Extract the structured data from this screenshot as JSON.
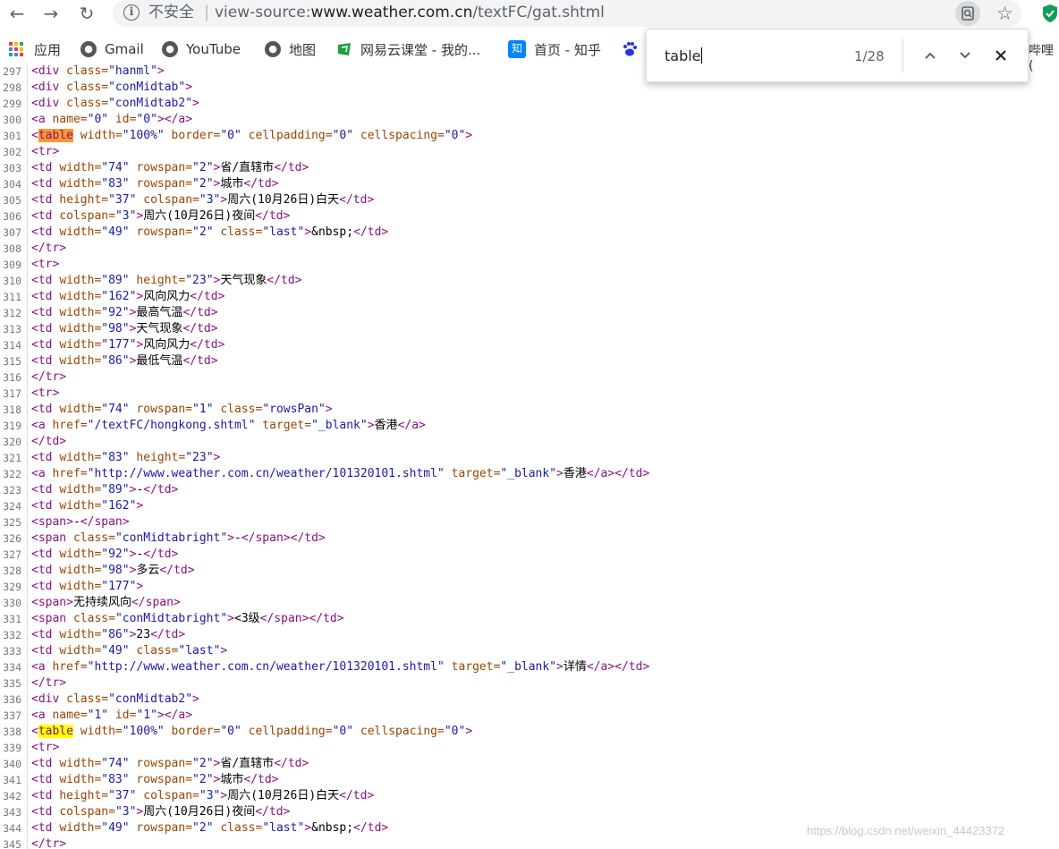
{
  "address_bar": {
    "security_label": "不安全",
    "separator": "|",
    "url_prefix": "view-source:",
    "url_domain": "www.weather.com.cn",
    "url_path": "/textFC/gat.shtml"
  },
  "bookmarks": [
    {
      "label": "应用",
      "icon": "apps-icon"
    },
    {
      "label": "Gmail",
      "icon": "globe-icon"
    },
    {
      "label": "YouTube",
      "icon": "globe-icon"
    },
    {
      "label": "地图",
      "icon": "globe-icon"
    },
    {
      "label": "网易云课堂 - 我的...",
      "icon": "netease-icon"
    },
    {
      "label": "首页 - 知乎",
      "icon": "zhihu-icon"
    },
    {
      "label": "",
      "icon": "baidu-icon"
    }
  ],
  "bookmarks_overflow_text": "哔哩 (",
  "find_bar": {
    "query": "table",
    "count": "1/28"
  },
  "source_lines": [
    {
      "n": "297",
      "html": "<span class=\"t\">&lt;div </span><span class=\"a\">class=</span><span class=\"v\">\"hanml\"</span><span class=\"t\">&gt;</span>"
    },
    {
      "n": "298",
      "html": "<span class=\"t\">&lt;div </span><span class=\"a\">class=</span><span class=\"v\">\"conMidtab\"</span><span class=\"t\">&gt;</span>"
    },
    {
      "n": "299",
      "html": "<span class=\"t\">&lt;div </span><span class=\"a\">class=</span><span class=\"v\">\"conMidtab2\"</span><span class=\"t\">&gt;</span>"
    },
    {
      "n": "300",
      "html": "<span class=\"t\">&lt;a </span><span class=\"a\">name=</span><span class=\"v\">\"0\"</span><span class=\"a\"> id=</span><span class=\"v\">\"0\"</span><span class=\"t\">&gt;&lt;/a&gt;</span>"
    },
    {
      "n": "301",
      "html": "<span class=\"t\">&lt;<span class=\"mt\">table</span> </span><span class=\"a\">width=</span><span class=\"v\">\"100%\"</span><span class=\"a\"> border=</span><span class=\"v\">\"0\"</span><span class=\"a\"> cellpadding=</span><span class=\"v\">\"0\"</span><span class=\"a\"> cellspacing=</span><span class=\"v\">\"0\"</span><span class=\"t\">&gt;</span>"
    },
    {
      "n": "302",
      "html": "<span class=\"t\">&lt;tr&gt;</span>"
    },
    {
      "n": "303",
      "html": "<span class=\"t\">&lt;td </span><span class=\"a\">width=</span><span class=\"v\">\"74\"</span><span class=\"a\"> rowspan=</span><span class=\"v\">\"2\"</span><span class=\"t\">&gt;</span>省/直辖市<span class=\"t\">&lt;/td&gt;</span>"
    },
    {
      "n": "304",
      "html": "<span class=\"t\">&lt;td </span><span class=\"a\">width=</span><span class=\"v\">\"83\"</span><span class=\"a\"> rowspan=</span><span class=\"v\">\"2\"</span><span class=\"t\">&gt;</span>城市<span class=\"t\">&lt;/td&gt;</span>"
    },
    {
      "n": "305",
      "html": "<span class=\"t\">&lt;td </span><span class=\"a\">height=</span><span class=\"v\">\"37\"</span><span class=\"a\"> colspan=</span><span class=\"v\">\"3\"</span><span class=\"t\">&gt;</span>周六(10月26日)白天<span class=\"t\">&lt;/td&gt;</span>"
    },
    {
      "n": "306",
      "html": "<span class=\"t\">&lt;td </span><span class=\"a\">colspan=</span><span class=\"v\">\"3\"</span><span class=\"t\">&gt;</span>周六(10月26日)夜间<span class=\"t\">&lt;/td&gt;</span>"
    },
    {
      "n": "307",
      "html": "<span class=\"t\">&lt;td </span><span class=\"a\">width=</span><span class=\"v\">\"49\"</span><span class=\"a\"> rowspan=</span><span class=\"v\">\"2\"</span><span class=\"a\"> class=</span><span class=\"v\">\"last\"</span><span class=\"t\">&gt;</span>&amp;nbsp;<span class=\"t\">&lt;/td&gt;</span>"
    },
    {
      "n": "308",
      "html": "<span class=\"t\">&lt;/tr&gt;</span>"
    },
    {
      "n": "309",
      "html": "<span class=\"t\">&lt;tr&gt;</span>"
    },
    {
      "n": "310",
      "html": "<span class=\"t\">&lt;td </span><span class=\"a\">width=</span><span class=\"v\">\"89\"</span><span class=\"a\"> height=</span><span class=\"v\">\"23\"</span><span class=\"t\">&gt;</span>天气现象<span class=\"t\">&lt;/td&gt;</span>"
    },
    {
      "n": "311",
      "html": "<span class=\"t\">&lt;td </span><span class=\"a\">width=</span><span class=\"v\">\"162\"</span><span class=\"t\">&gt;</span>风向风力<span class=\"t\">&lt;/td&gt;</span>"
    },
    {
      "n": "312",
      "html": "<span class=\"t\">&lt;td </span><span class=\"a\">width=</span><span class=\"v\">\"92\"</span><span class=\"t\">&gt;</span>最高气温<span class=\"t\">&lt;/td&gt;</span>"
    },
    {
      "n": "313",
      "html": "<span class=\"t\">&lt;td </span><span class=\"a\">width=</span><span class=\"v\">\"98\"</span><span class=\"t\">&gt;</span>天气现象<span class=\"t\">&lt;/td&gt;</span>"
    },
    {
      "n": "314",
      "html": "<span class=\"t\">&lt;td </span><span class=\"a\">width=</span><span class=\"v\">\"177\"</span><span class=\"t\">&gt;</span>风向风力<span class=\"t\">&lt;/td&gt;</span>"
    },
    {
      "n": "315",
      "html": "<span class=\"t\">&lt;td </span><span class=\"a\">width=</span><span class=\"v\">\"86\"</span><span class=\"t\">&gt;</span>最低气温<span class=\"t\">&lt;/td&gt;</span>"
    },
    {
      "n": "316",
      "html": "<span class=\"t\">&lt;/tr&gt;</span>"
    },
    {
      "n": "317",
      "html": "<span class=\"t\">&lt;tr&gt;</span>"
    },
    {
      "n": "318",
      "html": "<span class=\"t\">&lt;td </span><span class=\"a\">width=</span><span class=\"v\">\"74\"</span><span class=\"a\"> rowspan=</span><span class=\"v\">\"1\"</span><span class=\"a\"> class=</span><span class=\"v\">\"rowsPan\"</span><span class=\"t\">&gt;</span>"
    },
    {
      "n": "319",
      "html": "<span class=\"t\">&lt;a </span><span class=\"a\">href=</span><span class=\"v\">\"/textFC/hongkong.shtml\"</span><span class=\"a\"> target=</span><span class=\"v\">\"_blank\"</span><span class=\"t\">&gt;</span>香港<span class=\"t\">&lt;/a&gt;</span>"
    },
    {
      "n": "320",
      "html": "<span class=\"t\">&lt;/td&gt;</span>"
    },
    {
      "n": "321",
      "html": "<span class=\"t\">&lt;td </span><span class=\"a\">width=</span><span class=\"v\">\"83\"</span><span class=\"a\"> height=</span><span class=\"v\">\"23\"</span><span class=\"t\">&gt;</span>"
    },
    {
      "n": "322",
      "html": "<span class=\"t\">&lt;a </span><span class=\"a\">href=</span><span class=\"v\">\"http://www.weather.com.cn/weather/101320101.shtml\"</span><span class=\"a\"> target=</span><span class=\"v\">\"_blank\"</span><span class=\"t\">&gt;</span>香港<span class=\"t\">&lt;/a&gt;&lt;/td&gt;</span>"
    },
    {
      "n": "323",
      "html": "<span class=\"t\">&lt;td </span><span class=\"a\">width=</span><span class=\"v\">\"89\"</span><span class=\"t\">&gt;</span>-<span class=\"t\">&lt;/td&gt;</span>"
    },
    {
      "n": "324",
      "html": "<span class=\"t\">&lt;td </span><span class=\"a\">width=</span><span class=\"v\">\"162\"</span><span class=\"t\">&gt;</span>"
    },
    {
      "n": "325",
      "html": "<span class=\"t\">&lt;span&gt;</span>-<span class=\"t\">&lt;/span&gt;</span>"
    },
    {
      "n": "326",
      "html": "<span class=\"t\">&lt;span </span><span class=\"a\">class=</span><span class=\"v\">\"conMidtabright\"</span><span class=\"t\">&gt;</span>-<span class=\"t\">&lt;/span&gt;&lt;/td&gt;</span>"
    },
    {
      "n": "327",
      "html": "<span class=\"t\">&lt;td </span><span class=\"a\">width=</span><span class=\"v\">\"92\"</span><span class=\"t\">&gt;</span>-<span class=\"t\">&lt;/td&gt;</span>"
    },
    {
      "n": "328",
      "html": "<span class=\"t\">&lt;td </span><span class=\"a\">width=</span><span class=\"v\">\"98\"</span><span class=\"t\">&gt;</span>多云<span class=\"t\">&lt;/td&gt;</span>"
    },
    {
      "n": "329",
      "html": "<span class=\"t\">&lt;td </span><span class=\"a\">width=</span><span class=\"v\">\"177\"</span><span class=\"t\">&gt;</span>"
    },
    {
      "n": "330",
      "html": "<span class=\"t\">&lt;span&gt;</span>无持续风向<span class=\"t\">&lt;/span&gt;</span>"
    },
    {
      "n": "331",
      "html": "<span class=\"t\">&lt;span </span><span class=\"a\">class=</span><span class=\"v\">\"conMidtabright\"</span><span class=\"t\">&gt;</span>&lt;3级<span class=\"t\">&lt;/span&gt;&lt;/td&gt;</span>"
    },
    {
      "n": "332",
      "html": "<span class=\"t\">&lt;td </span><span class=\"a\">width=</span><span class=\"v\">\"86\"</span><span class=\"t\">&gt;</span>23<span class=\"t\">&lt;/td&gt;</span>"
    },
    {
      "n": "333",
      "html": "<span class=\"t\">&lt;td </span><span class=\"a\">width=</span><span class=\"v\">\"49\"</span><span class=\"a\"> class=</span><span class=\"v\">\"last\"</span><span class=\"t\">&gt;</span>"
    },
    {
      "n": "334",
      "html": "<span class=\"t\">&lt;a </span><span class=\"a\">href=</span><span class=\"v\">\"http://www.weather.com.cn/weather/101320101.shtml\"</span><span class=\"a\"> target=</span><span class=\"v\">\"_blank\"</span><span class=\"t\">&gt;</span>详情<span class=\"t\">&lt;/a&gt;&lt;/td&gt;</span>"
    },
    {
      "n": "335",
      "html": "<span class=\"t\">&lt;/tr&gt;</span>"
    },
    {
      "n": "336",
      "html": "<span class=\"t\">&lt;div </span><span class=\"a\">class=</span><span class=\"v\">\"conMidtab2\"</span><span class=\"t\">&gt;</span>"
    },
    {
      "n": "337",
      "html": "<span class=\"t\">&lt;a </span><span class=\"a\">name=</span><span class=\"v\">\"1\"</span><span class=\"a\"> id=</span><span class=\"v\">\"1\"</span><span class=\"t\">&gt;&lt;/a&gt;</span>"
    },
    {
      "n": "338",
      "html": "<span class=\"t\">&lt;<span class=\"mh\">table</span> </span><span class=\"a\">width=</span><span class=\"v\">\"100%\"</span><span class=\"a\"> border=</span><span class=\"v\">\"0\"</span><span class=\"a\"> cellpadding=</span><span class=\"v\">\"0\"</span><span class=\"a\"> cellspacing=</span><span class=\"v\">\"0\"</span><span class=\"t\">&gt;</span>"
    },
    {
      "n": "339",
      "html": "<span class=\"t\">&lt;tr&gt;</span>"
    },
    {
      "n": "340",
      "html": "<span class=\"t\">&lt;td </span><span class=\"a\">width=</span><span class=\"v\">\"74\"</span><span class=\"a\"> rowspan=</span><span class=\"v\">\"2\"</span><span class=\"t\">&gt;</span>省/直辖市<span class=\"t\">&lt;/td&gt;</span>"
    },
    {
      "n": "341",
      "html": "<span class=\"t\">&lt;td </span><span class=\"a\">width=</span><span class=\"v\">\"83\"</span><span class=\"a\"> rowspan=</span><span class=\"v\">\"2\"</span><span class=\"t\">&gt;</span>城市<span class=\"t\">&lt;/td&gt;</span>"
    },
    {
      "n": "342",
      "html": "<span class=\"t\">&lt;td </span><span class=\"a\">height=</span><span class=\"v\">\"37\"</span><span class=\"a\"> colspan=</span><span class=\"v\">\"3\"</span><span class=\"t\">&gt;</span>周六(10月26日)白天<span class=\"t\">&lt;/td&gt;</span>"
    },
    {
      "n": "343",
      "html": "<span class=\"t\">&lt;td </span><span class=\"a\">colspan=</span><span class=\"v\">\"3\"</span><span class=\"t\">&gt;</span>周六(10月26日)夜间<span class=\"t\">&lt;/td&gt;</span>"
    },
    {
      "n": "344",
      "html": "<span class=\"t\">&lt;td </span><span class=\"a\">width=</span><span class=\"v\">\"49\"</span><span class=\"a\"> rowspan=</span><span class=\"v\">\"2\"</span><span class=\"a\"> class=</span><span class=\"v\">\"last\"</span><span class=\"t\">&gt;</span>&amp;nbsp;<span class=\"t\">&lt;/td&gt;</span>"
    },
    {
      "n": "345",
      "html": "<span class=\"t\">&lt;/tr&gt;</span>"
    }
  ],
  "watermark": "https://blog.csdn.net/weixin_44423372"
}
